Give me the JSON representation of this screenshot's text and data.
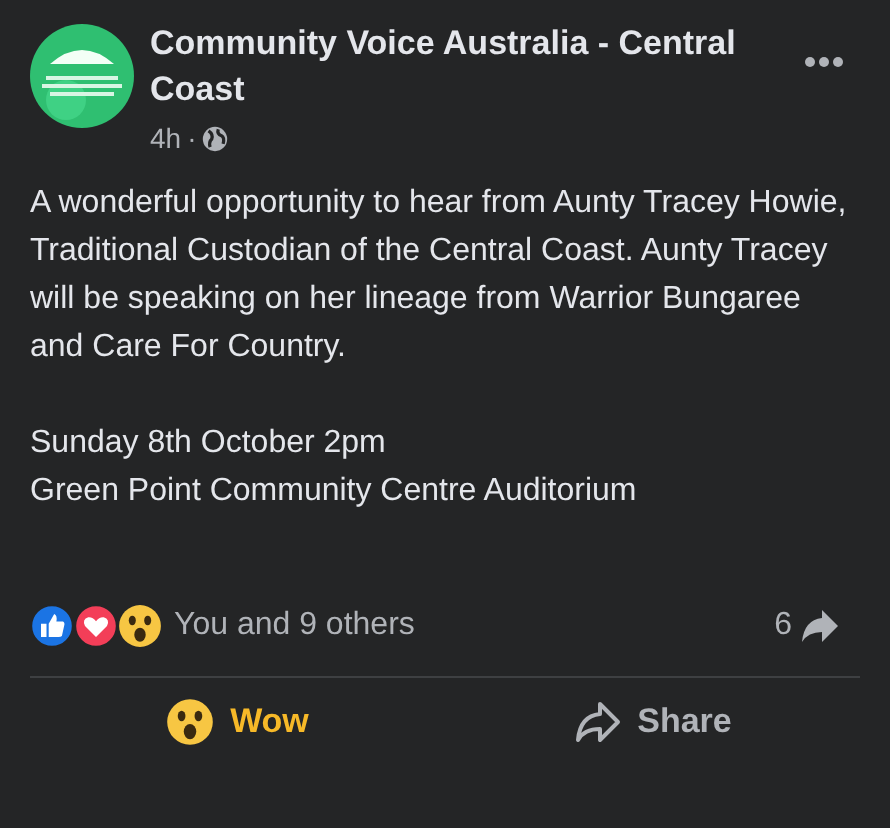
{
  "post": {
    "author": "Community Voice Australia - Central Coast",
    "time": "4h",
    "separator": "·",
    "paragraphs": [
      "A wonderful opportunity to hear from Aunty Tracey Howie, Traditional Custodian of the Central Coast. Aunty Tracey will be speaking on her lineage from Warrior Bungaree and Care For Country.",
      "Sunday 8th October 2pm\nGreen Point Community Centre Auditorium"
    ]
  },
  "reactions": {
    "types": [
      {
        "kind": "like"
      },
      {
        "kind": "love"
      },
      {
        "kind": "wow"
      }
    ],
    "summary": "You and 9 others",
    "shares": "6"
  },
  "actions": [
    {
      "kind": "wow",
      "label": "Wow",
      "selected": true
    },
    {
      "kind": "share",
      "label": "Share",
      "selected": false
    }
  ]
}
